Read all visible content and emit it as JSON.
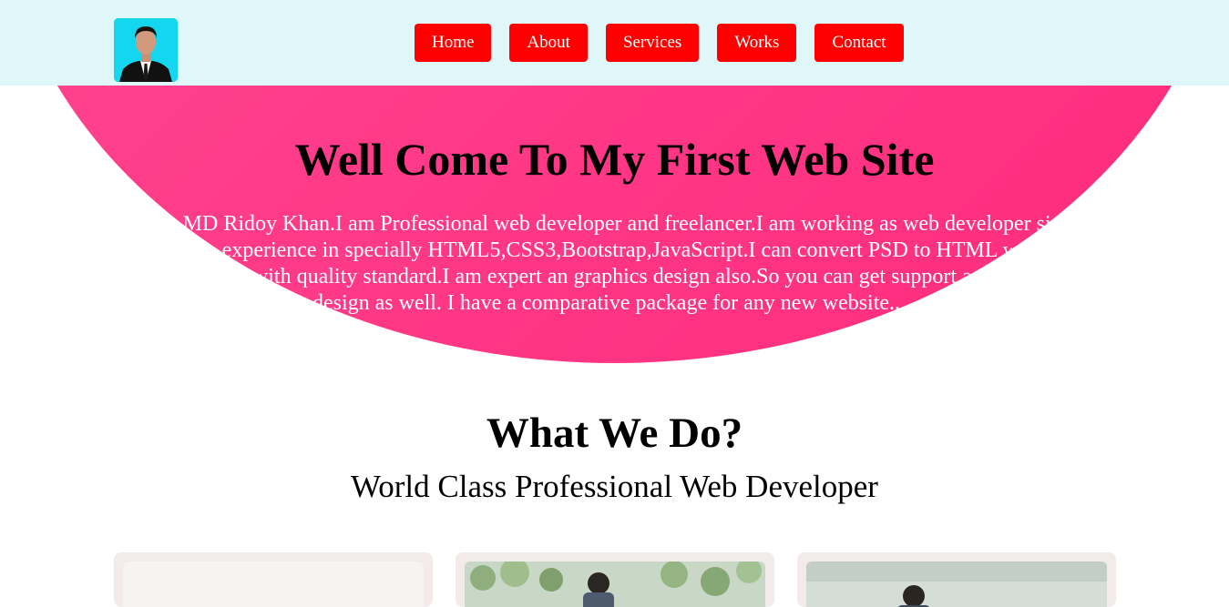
{
  "nav": {
    "items": [
      {
        "label": "Home"
      },
      {
        "label": "About"
      },
      {
        "label": "Services"
      },
      {
        "label": "Works"
      },
      {
        "label": "Contact"
      }
    ]
  },
  "hero": {
    "title": "Well Come To My First Web Site",
    "text": "Hi,i am MD Ridoy Khan.I am Professional web developer and freelancer.I am working as web developer since last year. I have experience in specially HTML5,CSS3,Bootstrap,JavaScript.I can convert PSD to HTML website with reasonable cost with quality standard.I am expert an graphics design also.So you can get support any web template design as well. I have a comparative package for any new website....."
  },
  "services": {
    "title": "What We Do?",
    "subtitle": "World Class Professional Web Developer"
  },
  "colors": {
    "header_bg": "#e0f7fa",
    "nav_button_bg": "#ff0000",
    "hero_pink": "#ff3d8a",
    "card_bg": "#f3eaea"
  }
}
